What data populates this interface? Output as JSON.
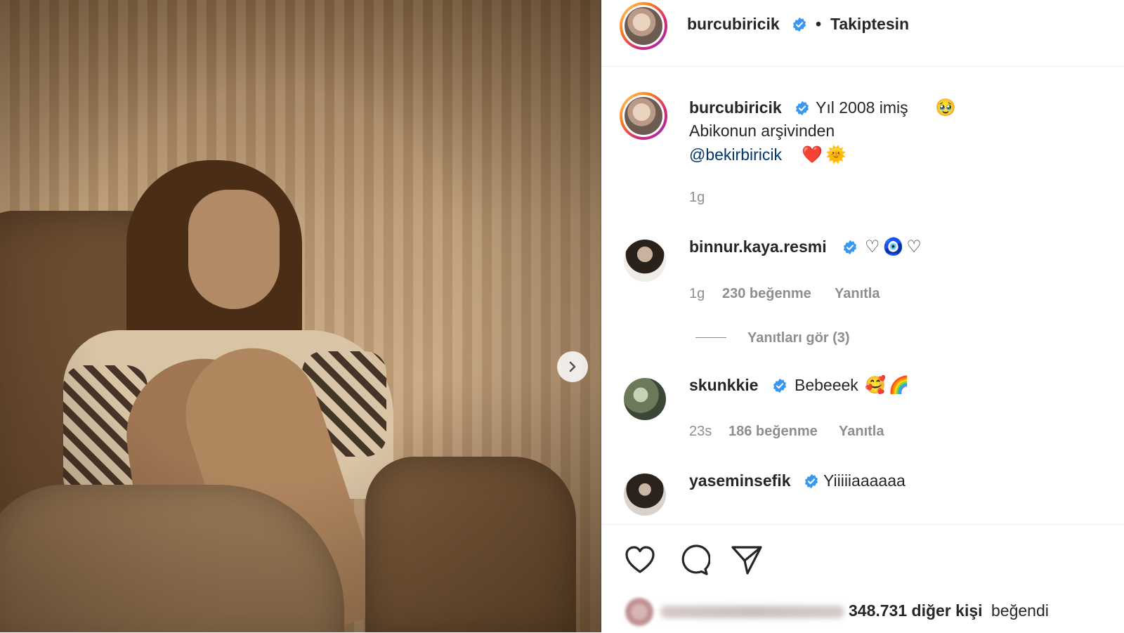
{
  "post": {
    "author": "burcubiricik",
    "follow_status": "Takiptesin",
    "separator": "•",
    "caption_line1": "Yıl 2008 imiş",
    "caption_emoji1": "🥹",
    "caption_line2": "Abikonun arşivinden",
    "mention": "@bekirbiricik",
    "caption_emoji2": "❤️",
    "caption_emoji3": "🌞",
    "caption_time": "1g"
  },
  "comments": [
    {
      "username": "binnur.kaya.resmi",
      "text": "♡🧿♡",
      "time": "1g",
      "likes": "230 beğenme",
      "reply": "Yanıtla",
      "view_replies": "Yanıtları gör (3)"
    },
    {
      "username": "skunkkie",
      "text": "Bebeeek",
      "emoji": "🥰🌈",
      "time": "23s",
      "likes": "186 beğenme",
      "reply": "Yanıtla"
    },
    {
      "username": "yaseminsefik",
      "text": "Yiiiiiaaaaaa"
    }
  ],
  "likes_summary": {
    "count_text": "348.731 diğer kişi",
    "suffix": "beğendi"
  },
  "colors": {
    "verified": "#3897f0",
    "link": "#00376b",
    "meta": "#8e8e8e"
  }
}
